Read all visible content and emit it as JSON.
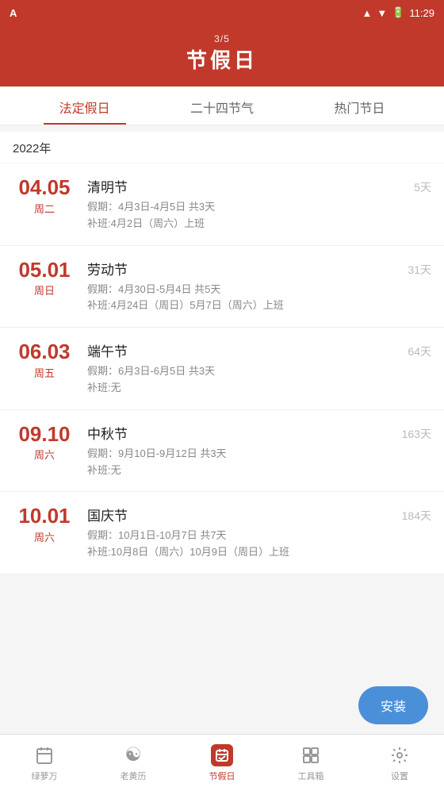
{
  "statusBar": {
    "left": "A",
    "time": "11:29"
  },
  "header": {
    "subtitle": "3/5",
    "title": "节假日"
  },
  "tabs": [
    {
      "id": "legal",
      "label": "法定假日",
      "active": true
    },
    {
      "id": "solar",
      "label": "二十四节气",
      "active": false
    },
    {
      "id": "popular",
      "label": "热门节日",
      "active": false
    }
  ],
  "yearLabel": "2022年",
  "holidays": [
    {
      "dateNum": "04.05",
      "dateWeek": "周二",
      "name": "清明节",
      "detail1": "假期：4月3日-4月5日 共3天",
      "detail2": "补班:4月2日（周六）上班",
      "daysCount": "5天"
    },
    {
      "dateNum": "05.01",
      "dateWeek": "周日",
      "name": "劳动节",
      "detail1": "假期：4月30日-5月4日 共5天",
      "detail2": "补班:4月24日（周日）5月7日（周六）上班",
      "daysCount": "31天"
    },
    {
      "dateNum": "06.03",
      "dateWeek": "周五",
      "name": "端午节",
      "detail1": "假期：6月3日-6月5日 共3天",
      "detail2": "补班:无",
      "daysCount": "64天"
    },
    {
      "dateNum": "09.10",
      "dateWeek": "周六",
      "name": "中秋节",
      "detail1": "假期：9月10日-9月12日 共3天",
      "detail2": "补班:无",
      "daysCount": "163天"
    },
    {
      "dateNum": "10.01",
      "dateWeek": "周六",
      "name": "国庆节",
      "detail1": "假期：10月1日-10月7日 共7天",
      "detail2": "补班:10月8日（周六）10月9日（周日）上班",
      "daysCount": "184天"
    }
  ],
  "installBtn": "安装",
  "bottomNav": [
    {
      "id": "calendar",
      "label": "绿萝万",
      "active": false,
      "icon": "calendar"
    },
    {
      "id": "almanac",
      "label": "老黄历",
      "active": false,
      "icon": "yinyang"
    },
    {
      "id": "holiday",
      "label": "节假日",
      "active": true,
      "icon": "holiday"
    },
    {
      "id": "toolbox",
      "label": "工具箱",
      "active": false,
      "icon": "toolbox"
    },
    {
      "id": "settings",
      "label": "设置",
      "active": false,
      "icon": "settings"
    }
  ]
}
